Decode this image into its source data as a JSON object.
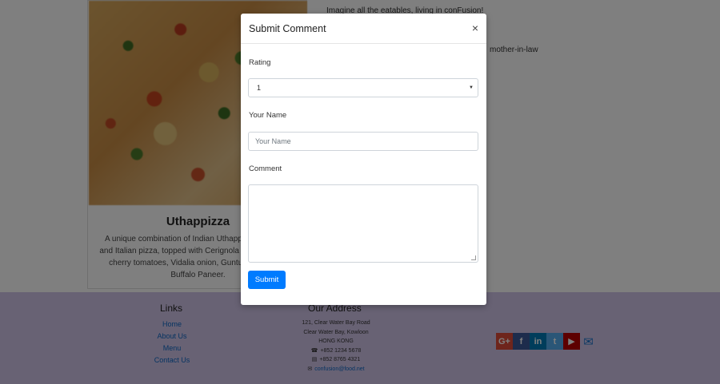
{
  "background": {
    "card": {
      "title": "Uthappizza",
      "description": "A unique combination of Indian Uthappam (pancake) and Italian pizza, topped with Cerignola olives, ripe vine cherry tomatoes, Vidalia onion, Guntur chillies and Buffalo Paneer."
    },
    "side_text_1": "Imagine all the eatables, living in conFusion!",
    "side_text_2": "mother-in-law"
  },
  "footer": {
    "links_title": "Links",
    "links": [
      "Home",
      "About Us",
      "Menu",
      "Contact Us"
    ],
    "address_title": "Our Address",
    "address_lines": [
      "121, Clear Water Bay Road",
      "Clear Water Bay, Kowloon",
      "HONG KONG"
    ],
    "phone": "+852 1234 5678",
    "fax": "+852 8765 4321",
    "email": "confusion@food.net",
    "social_icons": [
      "google-plus-icon",
      "facebook-icon",
      "linkedin-icon",
      "twitter-icon",
      "youtube-icon",
      "mail-icon"
    ]
  },
  "modal": {
    "title": "Submit Comment",
    "close": "×",
    "rating_label": "Rating",
    "rating_value": "1",
    "name_label": "Your Name",
    "name_placeholder": "Your Name",
    "comment_label": "Comment",
    "submit_label": "Submit"
  },
  "colors": {
    "primary": "#007bff",
    "footer_bg": "#d1c4e9",
    "overlay": "rgba(0,0,0,0.5)"
  }
}
